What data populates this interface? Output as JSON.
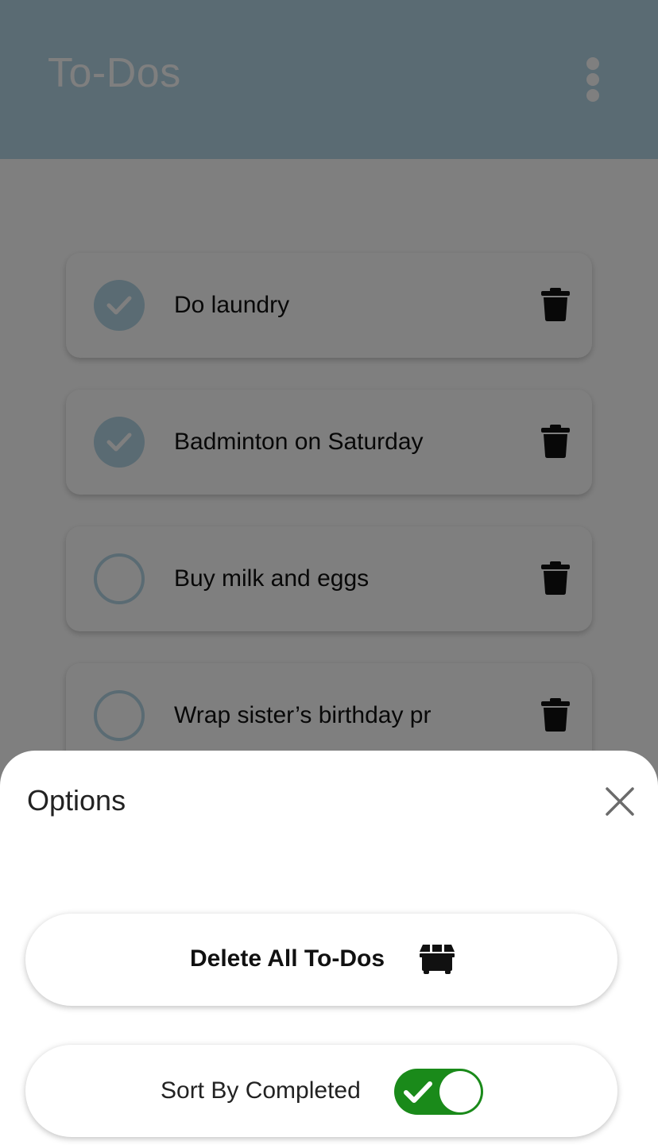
{
  "app": {
    "title": "To-Dos",
    "menu_icon": "more-vertical-icon",
    "accent_color": "#b5d6e6",
    "todos": [
      {
        "text": "Do laundry",
        "completed": true
      },
      {
        "text": "Badminton on Saturday",
        "completed": true
      },
      {
        "text": "Buy milk and eggs",
        "completed": false
      },
      {
        "text": "Wrap sister’s birthday pr",
        "completed": false
      }
    ]
  },
  "sheet": {
    "title": "Options",
    "close_icon": "close-icon",
    "delete_all_label": "Delete All To-Dos",
    "delete_all_icon": "dumpster-icon",
    "sort_label": "Sort By Completed",
    "sort_enabled": true,
    "toggle_color": "#1a8a1a"
  }
}
